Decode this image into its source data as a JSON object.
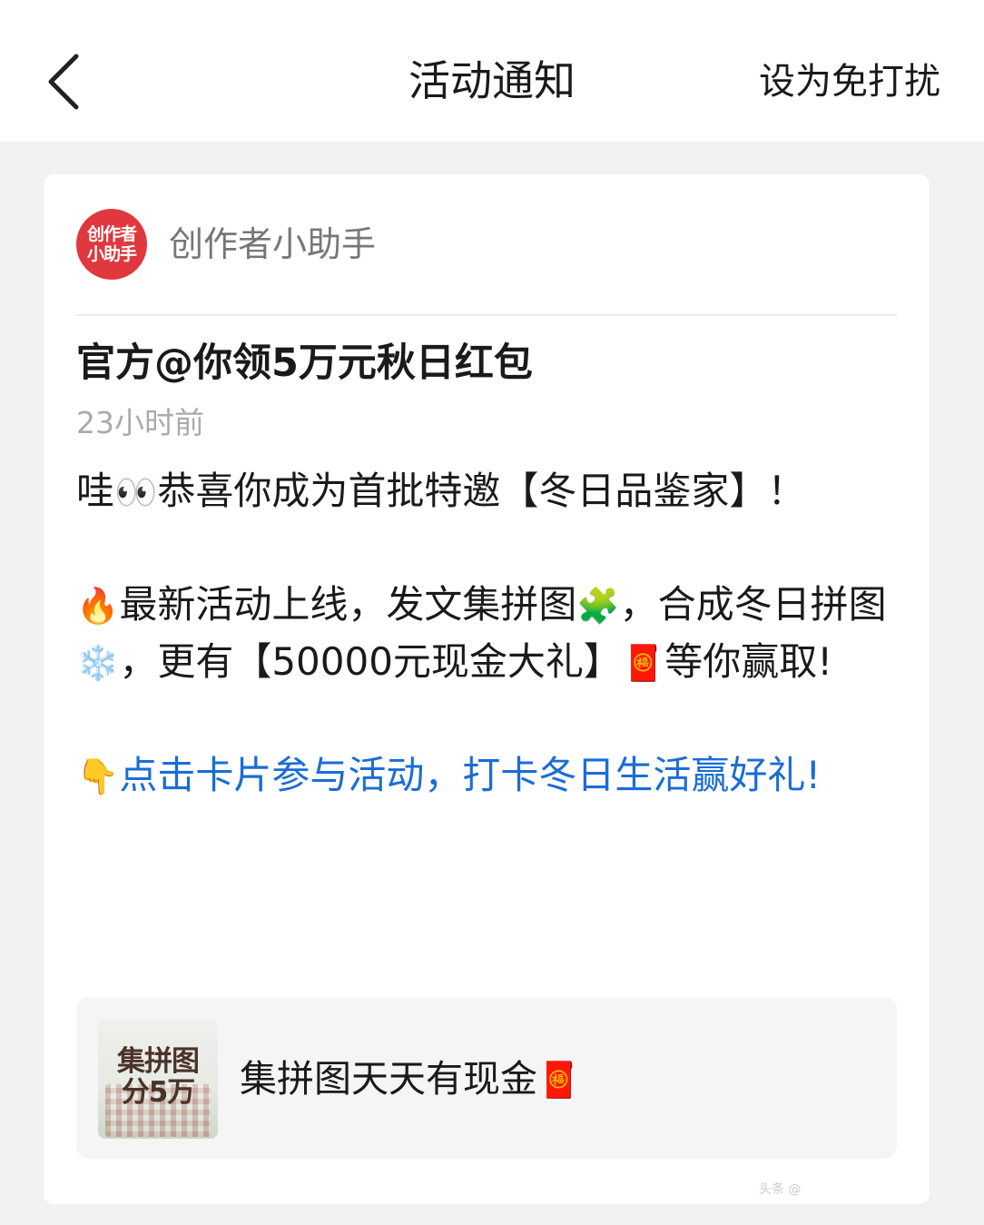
{
  "header": {
    "back_icon": "chevron-left-icon",
    "title": "活动通知",
    "dnd_label": "设为免打扰"
  },
  "sender": {
    "avatar_line1": "创作者",
    "avatar_line2": "小助手",
    "avatar_color": "#e0383e",
    "name": "创作者小助手"
  },
  "message": {
    "title": "官方@你领5万元秋日红包",
    "time": "23小时前",
    "para1": {
      "text_a": "哇",
      "emoji_eyes": "👀",
      "text_b": "恭喜你成为首批特邀【冬日品鉴家】！"
    },
    "para2": {
      "emoji_fire": "🔥",
      "text_a": "最新活动上线，发文集拼图",
      "emoji_puzzle": "🧩",
      "text_b": "，合成冬日拼图",
      "emoji_snow": "❄️",
      "text_c": "，更有【50000元现金大礼】",
      "emoji_envelope": "🧧",
      "text_d": "等你赢取!"
    },
    "para3": {
      "emoji_point": "👇",
      "text": "点击卡片参与活动，打卡冬日生活赢好礼!"
    },
    "link_color": "#1a6dd6"
  },
  "activity_card": {
    "thumb_line1": "集拼图",
    "thumb_line2": "分5万",
    "title": "集拼图天天有现金",
    "emoji_envelope": "🧧"
  },
  "watermark": "头条 @"
}
